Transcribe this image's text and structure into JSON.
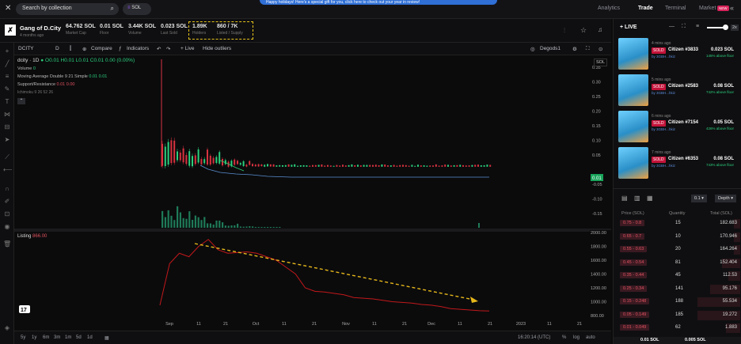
{
  "top": {
    "search_placeholder": "Search by collection",
    "chain": "SOL",
    "banner": "Happy holidays! Here's a special gift for you, click here to check out your year in review!",
    "nav": [
      "Analytics",
      "Trade",
      "Terminal",
      "Market"
    ],
    "market_badge": "NEW"
  },
  "collection": {
    "name": "Gang of D.City",
    "age": "4 months ago",
    "stats": [
      {
        "value": "64.762 SOL",
        "label": "Market Cap"
      },
      {
        "value": "0.01 SOL",
        "label": "Floor"
      },
      {
        "value": "3.44K SOL",
        "label": "Volume"
      },
      {
        "value": "0.023 SOL",
        "label": "Last Sold"
      },
      {
        "value": "1.89K",
        "label": "Holders"
      },
      {
        "value": "860 / 7K",
        "label": "Listed / Supply"
      }
    ]
  },
  "toolbar": {
    "symbol": "DCITY",
    "interval": "D",
    "compare": "Compare",
    "indicators": "Indicators",
    "live": "Live",
    "hide_outliers": "Hide outliers",
    "degods": "Degods1",
    "currency": "SOL"
  },
  "legend": {
    "title": "dcity · 1D",
    "ohlc": "O0.01 H0.01 L0.01 C0.01 0.00 (0.00%)",
    "volume": "Volume",
    "volume_val": "0",
    "ma": "Moving Average Double 9 21 Simple",
    "ma_vals": "0.01  0.01",
    "sr": "Support/Resistance",
    "sr_vals": "0.01  0.00",
    "ichimoku": "Ichimoku 9 26 52 26"
  },
  "listing": {
    "label": "Listing",
    "value": "866.00"
  },
  "chart_data": {
    "type": "line",
    "price_axis": [
      "0.35",
      "0.30",
      "0.25",
      "0.20",
      "0.15",
      "0.10",
      "0.05",
      "0.01",
      "-0.05",
      "-0.10",
      "-0.15"
    ],
    "listing_axis": [
      "2000.00",
      "1800.00",
      "1600.00",
      "1400.00",
      "1200.00",
      "1000.00",
      "800.00"
    ],
    "x_ticks": [
      "Sep",
      "11",
      "21",
      "Oct",
      "11",
      "21",
      "Nov",
      "11",
      "21",
      "Dec",
      "11",
      "21",
      "2023",
      "11",
      "21"
    ],
    "current_price_label": "0.01",
    "series": [
      {
        "name": "Listing",
        "values": [
          950,
          1550,
          1700,
          1650,
          1800,
          1900,
          1750,
          1700,
          1710,
          1720,
          1700,
          1650,
          1600,
          1500,
          1400,
          1200,
          1150,
          1140,
          1120,
          1100,
          1060,
          1050,
          1040,
          1020,
          1000,
          990,
          980,
          960,
          950,
          930,
          900,
          890,
          880,
          870,
          866
        ]
      }
    ]
  },
  "live": {
    "title": "LIVE",
    "zoom": "2x",
    "sales": [
      {
        "ago": "4 mins ago",
        "status": "SOLD",
        "name": "Citizen #3833",
        "by": "by 3GBH...hkiz",
        "price": "0.023 SOL",
        "pct": "145% above floor"
      },
      {
        "ago": "5 mins ago",
        "status": "SOLD",
        "name": "Citizen #2583",
        "by": "by 3GBH...hkiz",
        "price": "0.08 SOL",
        "pct": "742% above floor"
      },
      {
        "ago": "6 mins ago",
        "status": "SOLD",
        "name": "Citizen #7154",
        "by": "by 3GBH...hkiz",
        "price": "0.05 SOL",
        "pct": "426% above floor"
      },
      {
        "ago": "7 mins ago",
        "status": "SOLD",
        "name": "Citizen #6353",
        "by": "by 3GBH...hkiz",
        "price": "0.08 SOL",
        "pct": "743% above floor"
      }
    ]
  },
  "orderbook": {
    "step": "0.1",
    "mode": "Depth",
    "headers": [
      "Price (SOL)",
      "Quantity",
      "Total (SOL)"
    ],
    "rows": [
      {
        "price": "0.75 - 0.8",
        "qty": "15",
        "total": "182.683",
        "fill": 0.05
      },
      {
        "price": "0.65 - 0.7",
        "qty": "10",
        "total": "170.946",
        "fill": 0.05
      },
      {
        "price": "0.55 - 0.63",
        "qty": "20",
        "total": "164.264",
        "fill": 0.05
      },
      {
        "price": "0.45 - 0.54",
        "qty": "81",
        "total": "152.404",
        "fill": 0.15
      },
      {
        "price": "0.35 - 0.44",
        "qty": "45",
        "total": "112.53",
        "fill": 0.1
      },
      {
        "price": "0.25 - 0.34",
        "qty": "141",
        "total": "95.176",
        "fill": 0.25
      },
      {
        "price": "0.15 - 0.248",
        "qty": "188",
        "total": "55.534",
        "fill": 0.35
      },
      {
        "price": "0.05 - 0.149",
        "qty": "185",
        "total": "19.272",
        "fill": 0.35
      },
      {
        "price": "0.01 - 0.049",
        "qty": "62",
        "total": "1.883",
        "fill": 0.12
      }
    ],
    "footer_left": "0.01 SOL",
    "footer_right": "0.005 SOL"
  },
  "bottom": {
    "ranges": [
      "5y",
      "1y",
      "6m",
      "3m",
      "1m",
      "5d",
      "1d"
    ],
    "time": "16:20:14 (UTC)",
    "pct": "%",
    "log": "log",
    "auto": "auto"
  }
}
